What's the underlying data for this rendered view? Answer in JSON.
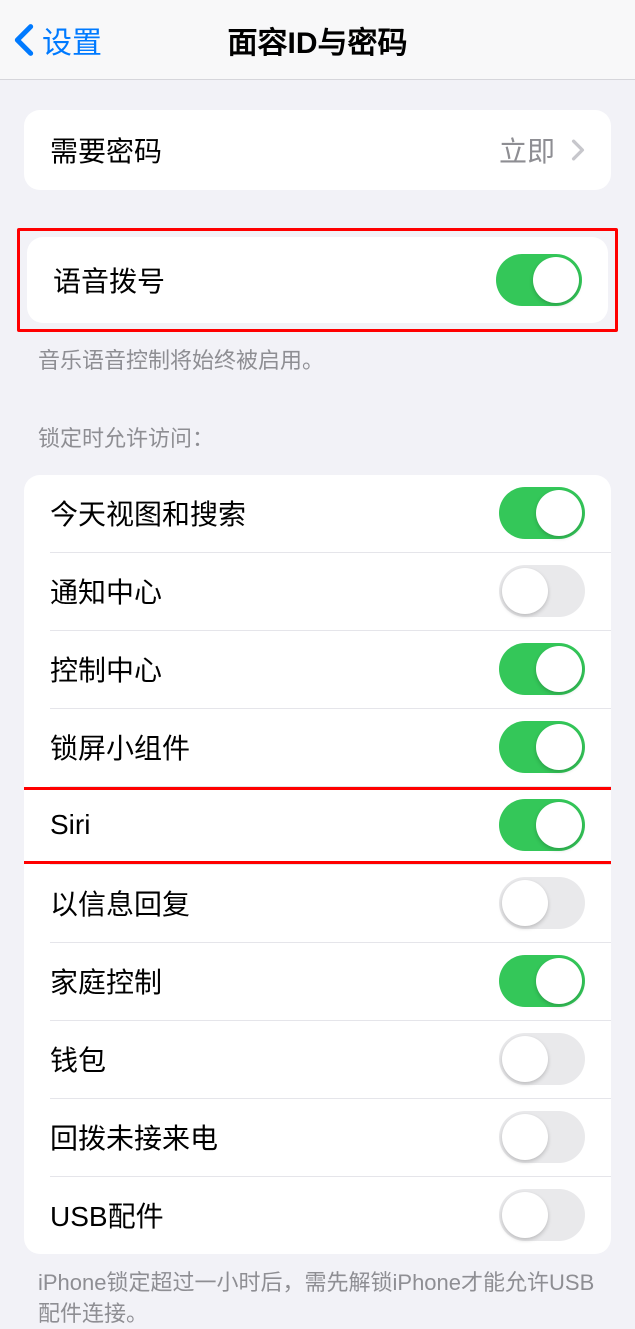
{
  "header": {
    "back_label": "设置",
    "title": "面容ID与密码"
  },
  "require_passcode": {
    "label": "需要密码",
    "value": "立即"
  },
  "voice_dial": {
    "label": "语音拨号",
    "enabled": true,
    "footer": "音乐语音控制将始终被启用。"
  },
  "lock_section": {
    "header": "锁定时允许访问：",
    "items": [
      {
        "label": "今天视图和搜索",
        "enabled": true
      },
      {
        "label": "通知中心",
        "enabled": false
      },
      {
        "label": "控制中心",
        "enabled": true
      },
      {
        "label": "锁屏小组件",
        "enabled": true
      },
      {
        "label": "Siri",
        "enabled": true
      },
      {
        "label": "以信息回复",
        "enabled": false
      },
      {
        "label": "家庭控制",
        "enabled": true
      },
      {
        "label": "钱包",
        "enabled": false
      },
      {
        "label": "回拨未接来电",
        "enabled": false
      },
      {
        "label": "USB配件",
        "enabled": false
      }
    ],
    "footer": "iPhone锁定超过一小时后，需先解锁iPhone才能允许USB配件连接。"
  }
}
